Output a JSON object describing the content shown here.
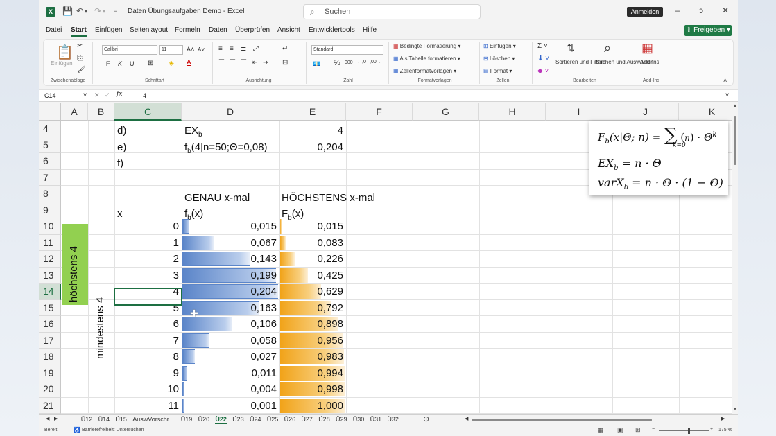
{
  "window": {
    "title": "Daten Übungsaufgaben Demo  -  Excel",
    "search_placeholder": "Suchen",
    "signin": "Anmelden",
    "minimize": "–",
    "restore": "ↄ",
    "close": "✕"
  },
  "menu": {
    "items": [
      "Datei",
      "Start",
      "Einfügen",
      "Seitenlayout",
      "Formeln",
      "Daten",
      "Überprüfen",
      "Ansicht",
      "Entwicklertools",
      "Hilfe"
    ],
    "share": "Freigeben"
  },
  "ribbon": {
    "clipboard_label": "Zwischenablage",
    "paste": "Einfügen",
    "font_label": "Schriftart",
    "font_name": "Calibri",
    "font_size": "11",
    "bold": "F",
    "italic": "K",
    "underline": "U",
    "alignment_label": "Ausrichtung",
    "number_label": "Zahl",
    "number_format": "Standard",
    "styles_label": "Formatvorlagen",
    "cond_format": "Bedingte Formatierung",
    "as_table": "Als Tabelle formatieren",
    "cell_styles": "Zellenformatvorlagen",
    "cells_label": "Zellen",
    "insert": "Einfügen",
    "delete": "Löschen",
    "format": "Format",
    "editing_label": "Bearbeiten",
    "sort_filter": "Sortieren und Filtern",
    "find_select": "Suchen und Auswählen",
    "addins_label": "Add-Ins",
    "addins": "Add-Ins"
  },
  "formula_bar": {
    "name_box": "C14",
    "fx": "fx",
    "content": "4"
  },
  "columns": [
    "A",
    "B",
    "C",
    "D",
    "E",
    "F",
    "G",
    "H",
    "I",
    "J",
    "K"
  ],
  "rows": [
    "4",
    "5",
    "6",
    "7",
    "8",
    "9",
    "10",
    "11",
    "12",
    "13",
    "14",
    "15",
    "16",
    "17",
    "18",
    "19",
    "20",
    "21"
  ],
  "cells": {
    "c4": "d)",
    "d4_main": "EX",
    "d4_sub": "b",
    "e4": "4",
    "c5": "e)",
    "d5_main": "f",
    "d5_sub": "b",
    "d5_rest": "(4|n=50;Θ=0,08)",
    "e5": "0,204",
    "c6": "f)",
    "d8": "GENAU x-mal",
    "e8": "HÖCHSTENS x-mal",
    "c9": "x",
    "d9_main": "f",
    "d9_sub": "b",
    "d9_rest": "(x)",
    "e9_main": "F",
    "e9_sub": "b",
    "e9_rest": "(x)",
    "a_merge": "höchstens 4",
    "b_merge": "mindestens 4"
  },
  "table": {
    "x": [
      "0",
      "1",
      "2",
      "3",
      "4",
      "5",
      "6",
      "7",
      "8",
      "9",
      "10",
      "11"
    ],
    "fb": [
      "0,015",
      "0,067",
      "0,143",
      "0,199",
      "0,204",
      "0,163",
      "0,106",
      "0,058",
      "0,027",
      "0,011",
      "0,004",
      "0,001"
    ],
    "Fb": [
      "0,015",
      "0,083",
      "0,226",
      "0,425",
      "0,629",
      "0,792",
      "0,898",
      "0,956",
      "0,983",
      "0,994",
      "0,998",
      "1,000"
    ],
    "fb_values": [
      0.015,
      0.067,
      0.143,
      0.199,
      0.204,
      0.163,
      0.106,
      0.058,
      0.027,
      0.011,
      0.004,
      0.001
    ],
    "Fb_values": [
      0.015,
      0.083,
      0.226,
      0.425,
      0.629,
      0.792,
      0.898,
      0.956,
      0.983,
      0.994,
      0.998,
      1.0
    ]
  },
  "formulas": {
    "line1": "F_b(x|Θ; n) = Σ_{k=0} (n k) · Θ^k",
    "line2": "EX_b = n · Θ",
    "line3": "varX_b = n · Θ · (1 − Θ)"
  },
  "sheet_tabs": [
    "...",
    "Ü12",
    "Ü14",
    "Ü15",
    "AuswVorschr",
    "Ü19",
    "Ü20",
    "Ü22",
    "Ü23",
    "Ü24",
    "Ü25",
    "Ü26",
    "Ü27",
    "Ü28",
    "Ü29",
    "Ü30",
    "Ü31",
    "Ü32"
  ],
  "active_tab": "Ü22",
  "status": {
    "ready": "Bereit",
    "accessibility": "Barrierefreiheit: Untersuchen",
    "zoom": "175 %"
  },
  "colors": {
    "excel_green": "#1d6f42",
    "merge_green": "#92d050",
    "databar_blue": "#5b85c9",
    "databar_orange": "#f1a319"
  }
}
